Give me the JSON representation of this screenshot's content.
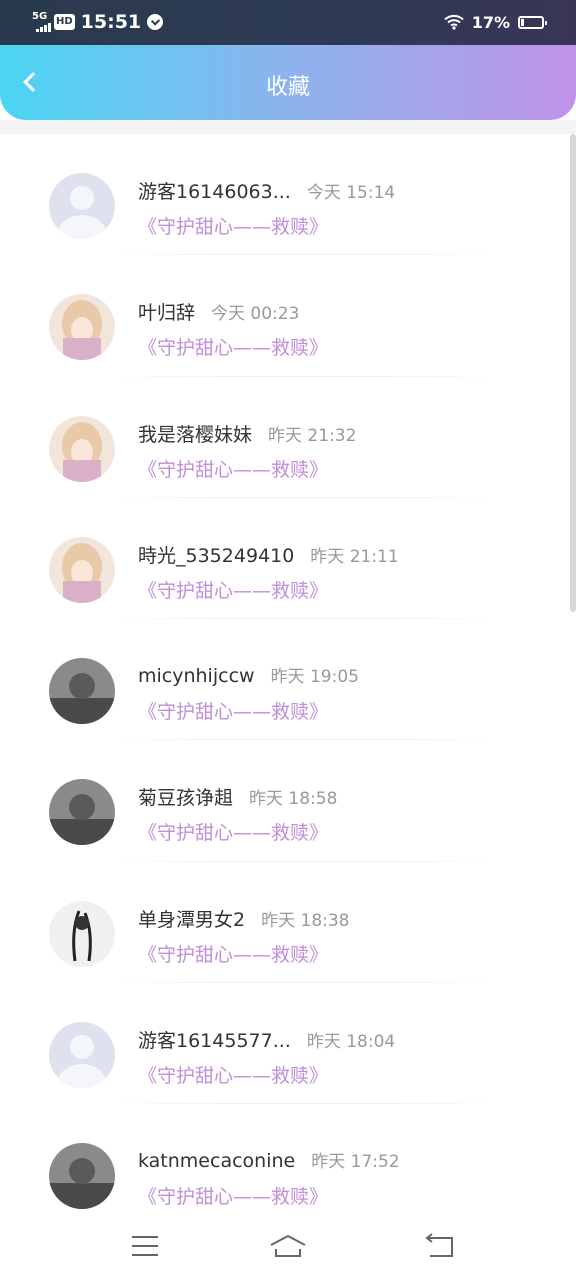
{
  "status_bar": {
    "network": "5G",
    "hd": "HD",
    "time": "15:51",
    "battery_percent": "17%",
    "battery_level": 0.17,
    "icons": [
      "signal-icon",
      "hd-icon",
      "alarm-icon",
      "wifi-icon",
      "battery-icon"
    ]
  },
  "header": {
    "title": "收藏",
    "back_icon": "chevron-left-icon",
    "gradient": [
      "#4ad6f2",
      "#bf93ea"
    ]
  },
  "colors": {
    "book_title": "#c28ed8",
    "name": "#333333",
    "time": "#999999"
  },
  "favorites": [
    {
      "name": "游客16146063...",
      "time": "今天 15:14",
      "book": "《守护甜心——救赎》",
      "avatar": "default-avatar"
    },
    {
      "name": "叶归辞",
      "time": "今天 00:23",
      "book": "《守护甜心——救赎》",
      "avatar": "anime-girl-avatar"
    },
    {
      "name": "我是落樱妹妹",
      "time": "昨天 21:32",
      "book": "《守护甜心——救赎》",
      "avatar": "anime-girl-avatar"
    },
    {
      "name": "時光_535249410",
      "time": "昨天 21:11",
      "book": "《守护甜心——救赎》",
      "avatar": "anime-girl-avatar"
    },
    {
      "name": "micynhijccw",
      "time": "昨天 19:05",
      "book": "《守护甜心——救赎》",
      "avatar": "photo-avatar"
    },
    {
      "name": "菊豆孩诤趄",
      "time": "昨天 18:58",
      "book": "《守护甜心——救赎》",
      "avatar": "photo-avatar"
    },
    {
      "name": "单身潭男女2",
      "time": "昨天 18:38",
      "book": "《守护甜心——救赎》",
      "avatar": "sketch-avatar"
    },
    {
      "name": "游客16145577...",
      "time": "昨天 18:04",
      "book": "《守护甜心——救赎》",
      "avatar": "default-avatar"
    },
    {
      "name": "katnmecaconine",
      "time": "昨天 17:52",
      "book": "《守护甜心——救赎》",
      "avatar": "photo-avatar"
    }
  ],
  "nav_bar": {
    "icons": [
      "menu-icon",
      "home-icon",
      "back-icon"
    ]
  }
}
